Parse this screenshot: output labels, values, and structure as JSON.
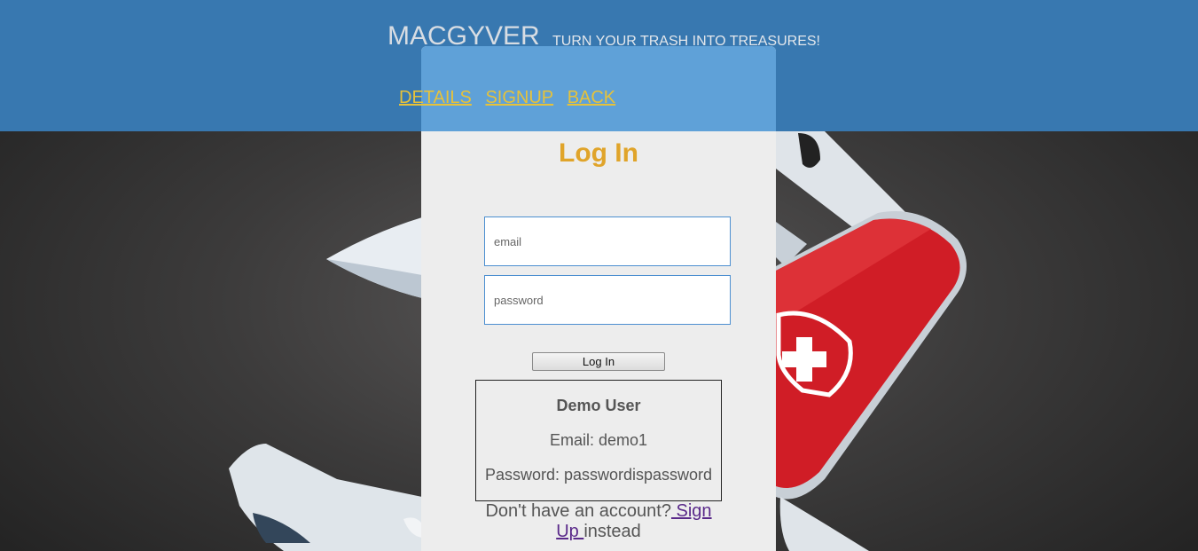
{
  "header": {
    "brand": "MACGYVER",
    "tagline": "TURN YOUR TRASH INTO TREASURES!",
    "nav": [
      "DETAILS",
      "SIGNUP",
      "BACK"
    ]
  },
  "login": {
    "title": "Log In",
    "email_placeholder": "email",
    "password_placeholder": "password",
    "button_label": "Log In"
  },
  "demo": {
    "title": "Demo User",
    "email": "Email: demo1",
    "password": "Password: passwordispassword"
  },
  "footer": {
    "prefix": "Don't have an account?",
    "link": " Sign Up ",
    "suffix": "instead"
  },
  "colors": {
    "header_bg": "#3878b0",
    "panel_top": "#5fa1d8",
    "panel_bg": "#ededed",
    "title": "#e0a42a",
    "nav_link": "#e6c23a",
    "knife_red": "#d01d26"
  },
  "icons": {
    "background": "swiss-army-knife-image"
  }
}
